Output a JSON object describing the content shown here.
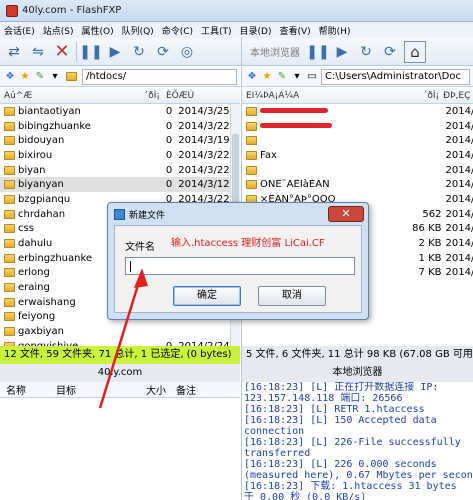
{
  "window": {
    "title": "40ly.com - FlashFXP"
  },
  "watermark": {
    "text": "Baidu 经验"
  },
  "menu": [
    "会话(E)",
    "站点(S)",
    "属性(O)",
    "队列(Q)",
    "命令(C)",
    "工具(T)",
    "目录(D)",
    "查看(V)",
    "帮助(H)"
  ],
  "toolbar_right": {
    "label": "本地浏览器"
  },
  "left": {
    "path": "/htdocs/",
    "headers": {
      "name": "Âû^Æ",
      "size": "´ðÌ¡",
      "date": "ÈÕÆÚ"
    },
    "rows": [
      {
        "name": "biantaotiyan",
        "size": "0",
        "date": "2014/3/25"
      },
      {
        "name": "bibingzhuanke",
        "size": "0",
        "date": "2014/3/22"
      },
      {
        "name": "bidouyan",
        "size": "0",
        "date": "2014/3/19"
      },
      {
        "name": "bixirou",
        "size": "0",
        "date": "2014/3/22"
      },
      {
        "name": "biyan",
        "size": "0",
        "date": "2014/3/22"
      },
      {
        "name": "biyanyan",
        "size": "0",
        "date": "2014/3/12"
      },
      {
        "name": "bzgpianqu",
        "size": "0",
        "date": "2014/3/22"
      },
      {
        "name": "chrdahan",
        "size": "",
        "date": ""
      },
      {
        "name": "css",
        "size": "",
        "date": ""
      },
      {
        "name": "dahulu",
        "size": "",
        "date": ""
      },
      {
        "name": "erbingzhuanke",
        "size": "",
        "date": ""
      },
      {
        "name": "erlong",
        "size": "",
        "date": ""
      },
      {
        "name": "eraing",
        "size": "",
        "date": ""
      },
      {
        "name": "erwaishang",
        "size": "",
        "date": ""
      },
      {
        "name": "feiyong",
        "size": "",
        "date": ""
      },
      {
        "name": "gaxbiyan",
        "size": "",
        "date": ""
      },
      {
        "name": "gongyishiye",
        "size": "0",
        "date": "2014/2/24"
      }
    ],
    "status": "12 文件, 59 文件夹, 71 总计, 1 已选定, (0 bytes)",
    "site": "40ly.com"
  },
  "right": {
    "path": "C:\\Users\\Administrator\\Doc",
    "headers": {
      "name": "ÉÎ¼ÞÃ¡Ã¼Ã",
      "size": "´ðÌ¡",
      "date": "ÐÞ,ÊÇ"
    },
    "rows": [
      {
        "name": "",
        "size": "",
        "date": "2014/"
      },
      {
        "name": "",
        "size": "",
        "date": "2014/"
      },
      {
        "name": "",
        "size": "",
        "date": "2014/"
      },
      {
        "name": "Fax",
        "size": "",
        "date": "2014/"
      },
      {
        "name": "",
        "size": "",
        "date": "2014/"
      },
      {
        "name": "ÕÑÉ¨ÃÊÍàÈÃÑ",
        "size": "",
        "date": "2014/"
      },
      {
        "name": "×ÊÃÑ°ÀÞ°ÒÒÒ",
        "size": "",
        "date": "2014/"
      },
      {
        "name": "",
        "size": "562",
        "date": "2014/"
      },
      {
        "name": "",
        "size": "86 KB",
        "date": "2014/"
      },
      {
        "name": "",
        "size": "2 KB",
        "date": "2014/"
      },
      {
        "name": "",
        "size": "1 KB",
        "date": "2014/"
      },
      {
        "name": "",
        "size": "7 KB",
        "date": "2014/"
      }
    ],
    "status": "5 文件, 6 文件夹, 11 总计 98 KB (67.08 GB 可用)",
    "site": "本地浏览器"
  },
  "queue": {
    "headers": {
      "name": "名称",
      "target": "目标",
      "size": "大小",
      "note": "备注"
    }
  },
  "log": [
    "[16:18:23] [L] 正在打开数据连接 IP:",
    "123.157.148.118 端口: 26566",
    "[16:18:23] [L] RETR 1.htaccess",
    "[16:18:23] [L] 150 Accepted data",
    "connection",
    "[16:18:23] [L] 226-File successfully",
    "transferred",
    "[16:18:23] [L] 226 0.000 seconds",
    "(measured here), 0.67 Mbytes per second",
    "[16:18:23] 下载: 1.htaccess 31 bytes",
    "于 0.00 秒 (0.0 KB/s)"
  ],
  "dialog": {
    "title": "新建文件",
    "label": "文件名",
    "hint": "输入.htaccess 理财创富 LiCai.CF",
    "value": "",
    "ok": "确定",
    "cancel": "取消",
    "close": "✕"
  }
}
